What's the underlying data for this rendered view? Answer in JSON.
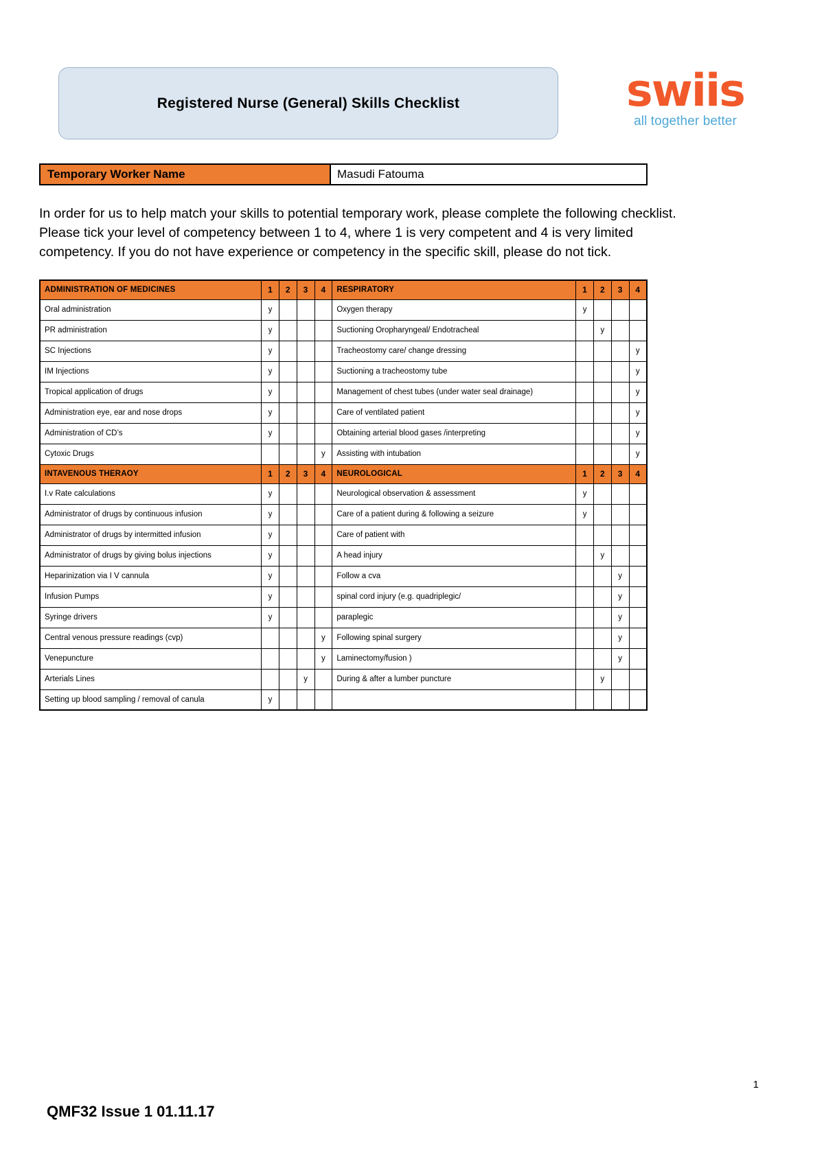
{
  "document": {
    "title": "Registered Nurse (General) Skills Checklist",
    "logo": {
      "wordmark": "swiis",
      "tagline": "all together better",
      "brand_color": "#f1592a",
      "tagline_color": "#4fa8d8"
    },
    "name_band": {
      "label": "Temporary Worker Name",
      "value": "Masudi Fatouma"
    },
    "intro": "In order for us to help match your skills to potential temporary work, please complete the following checklist.  Please tick your level of competency between 1 to 4, where 1 is very competent and 4 is very limited competency.  If you do not have experience or competency in the specific skill, please do not tick.",
    "footer": {
      "page_number": "1",
      "code": "QMF32 Issue 1 01.11.17"
    },
    "accent_color": "#ed7d31",
    "title_box_color": "#dce6f1"
  },
  "score_headers": [
    "1",
    "2",
    "3",
    "4"
  ],
  "tick_mark": "y",
  "table": {
    "left_sections": [
      {
        "heading": "ADMINISTRATION OF MEDICINES",
        "rows": [
          {
            "skill": "Oral administration",
            "score": 1
          },
          {
            "skill": "PR administration",
            "score": 1
          },
          {
            "skill": "SC Injections",
            "score": 1
          },
          {
            "skill": "IM Injections",
            "score": 1
          },
          {
            "skill": "Tropical application of drugs",
            "score": 1
          },
          {
            "skill": "Administration eye, ear and nose drops",
            "score": 1
          },
          {
            "skill": "Administration of CD’s",
            "score": 1
          },
          {
            "skill": "Cytoxic Drugs",
            "score": 4
          }
        ]
      },
      {
        "heading": "INTAVENOUS THERAOY",
        "rows": [
          {
            "skill": "I.v Rate calculations",
            "score": 1
          },
          {
            "skill": "Administrator of drugs by continuous infusion",
            "score": 1
          },
          {
            "skill": "Administrator of drugs by intermitted infusion",
            "score": 1
          },
          {
            "skill": "Administrator of drugs by  giving bolus injections",
            "score": 1
          },
          {
            "skill": "Heparinization via I V cannula",
            "score": 1
          },
          {
            "skill": "Infusion Pumps",
            "score": 1
          },
          {
            "skill": "Syringe drivers",
            "score": 1
          },
          {
            "skill": "Central venous pressure readings (cvp)",
            "score": 4
          },
          {
            "skill": "Venepuncture",
            "score": 4
          },
          {
            "skill": "Arterials Lines",
            "score": 3
          },
          {
            "skill": "Setting up blood sampling / removal of canula",
            "score": 1
          }
        ]
      }
    ],
    "right_sections": [
      {
        "heading": "RESPIRATORY",
        "rows": [
          {
            "skill": "Oxygen therapy",
            "score": 1
          },
          {
            "skill": "Suctioning Oropharyngeal/ Endotracheal",
            "score": 2
          },
          {
            "skill": "Tracheostomy care/ change dressing",
            "score": 4
          },
          {
            "skill": "Suctioning a tracheostomy tube",
            "score": 4
          },
          {
            "skill": "Management of chest tubes (under water seal drainage)",
            "score": 4
          },
          {
            "skill": "Care of ventilated patient",
            "score": 4
          },
          {
            "skill": "Obtaining arterial blood gases /interpreting",
            "score": 4
          },
          {
            "skill": "Assisting with intubation",
            "score": 4
          }
        ]
      },
      {
        "heading": "NEUROLOGICAL",
        "rows": [
          {
            "skill": "Neurological observation & assessment",
            "score": 1
          },
          {
            "skill": "Care of a patient during & following a seizure",
            "score": 1
          },
          {
            "skill": "Care of patient with",
            "score": 0
          },
          {
            "skill": "A head injury",
            "score": 2
          },
          {
            "skill": "Follow a cva",
            "score": 3
          },
          {
            "skill": "spinal cord injury (e.g. quadriplegic/",
            "score": 3
          },
          {
            "skill": "paraplegic",
            "score": 3
          },
          {
            "skill": "Following spinal surgery",
            "score": 3
          },
          {
            "skill": "Laminectomy/fusion )",
            "score": 3
          },
          {
            "skill": "During & after a lumber puncture",
            "score": 2
          },
          {
            "skill": "",
            "score": 0
          }
        ]
      }
    ]
  }
}
